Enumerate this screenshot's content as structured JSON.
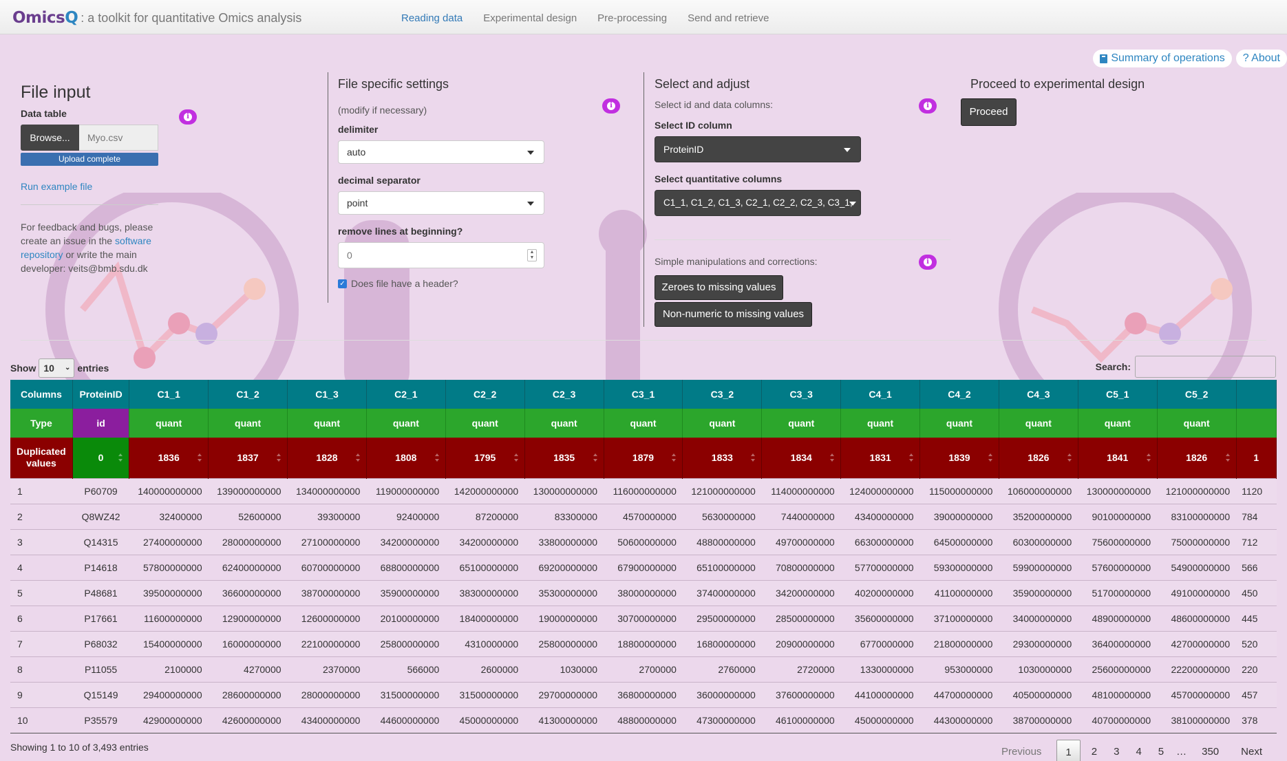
{
  "nav": {
    "brand": "Omics",
    "brand_q": "Q",
    "subtitle": ": a toolkit for quantitative Omics analysis",
    "tabs": [
      "Reading data",
      "Experimental design",
      "Pre-processing",
      "Send and retrieve"
    ],
    "active_tab": "Reading data"
  },
  "top_buttons": {
    "summary": "Summary of operations",
    "about": "? About"
  },
  "file_input": {
    "title": "File input",
    "data_table_label": "Data table",
    "browse_label": "Browse...",
    "file_name": "Myo.csv",
    "upload_status": "Upload complete",
    "run_example": "Run example file",
    "feedback_1": "For feedback and bugs, please create an issue in the",
    "feedback_link": "software repository",
    "feedback_2": "or write the main developer: veits@bmb.sdu.dk"
  },
  "file_settings": {
    "title": "File specific settings",
    "subtitle": "(modify if necessary)",
    "delimiter_label": "delimiter",
    "delimiter_value": "auto",
    "decimal_label": "decimal separator",
    "decimal_value": "point",
    "remove_lines_label": "remove lines at beginning?",
    "remove_lines_value": "0",
    "header_label": "Does file have a header?",
    "header_checked": true
  },
  "select_adjust": {
    "title": "Select and adjust",
    "subtitle": "Select id and data columns:",
    "id_label": "Select ID column",
    "id_value": "ProteinID",
    "quant_label": "Select quantitative columns",
    "quant_value": "C1_1, C1_2, C1_3, C2_1, C2_2, C2_3, C3_1,",
    "manip_label": "Simple manipulations and corrections:",
    "zeroes_btn": "Zeroes to missing values",
    "nonnumeric_btn": "Non-numeric to missing values"
  },
  "proceed": {
    "title": "Proceed to experimental design",
    "button": "Proceed"
  },
  "table_controls": {
    "show_label": "Show",
    "show_value": "10",
    "entries_label": "entries",
    "search_label": "Search:",
    "info": "Showing 1 to 10 of 3,493 entries"
  },
  "table": {
    "row_label_columns": "Columns",
    "row_label_type": "Type",
    "row_label_dup": "Duplicated values",
    "columns": [
      "ProteinID",
      "C1_1",
      "C1_2",
      "C1_3",
      "C2_1",
      "C2_2",
      "C2_3",
      "C3_1",
      "C3_2",
      "C3_3",
      "C4_1",
      "C4_2",
      "C4_3",
      "C5_1",
      "C5_2",
      ""
    ],
    "types": [
      "id",
      "quant",
      "quant",
      "quant",
      "quant",
      "quant",
      "quant",
      "quant",
      "quant",
      "quant",
      "quant",
      "quant",
      "quant",
      "quant",
      "quant",
      ""
    ],
    "duplicates": [
      "0",
      "1836",
      "1837",
      "1828",
      "1808",
      "1795",
      "1835",
      "1879",
      "1833",
      "1834",
      "1831",
      "1839",
      "1826",
      "1841",
      "1826",
      "1"
    ],
    "rows": [
      [
        "1",
        "P60709",
        "140000000000",
        "139000000000",
        "134000000000",
        "119000000000",
        "142000000000",
        "130000000000",
        "116000000000",
        "121000000000",
        "114000000000",
        "124000000000",
        "115000000000",
        "106000000000",
        "130000000000",
        "121000000000",
        "1120"
      ],
      [
        "2",
        "Q8WZ42",
        "32400000",
        "52600000",
        "39300000",
        "92400000",
        "87200000",
        "83300000",
        "4570000000",
        "5630000000",
        "7440000000",
        "43400000000",
        "39000000000",
        "35200000000",
        "90100000000",
        "83100000000",
        "784"
      ],
      [
        "3",
        "Q14315",
        "27400000000",
        "28000000000",
        "27100000000",
        "34200000000",
        "34200000000",
        "33800000000",
        "50600000000",
        "48800000000",
        "49700000000",
        "66300000000",
        "64500000000",
        "60300000000",
        "75600000000",
        "75000000000",
        "712"
      ],
      [
        "4",
        "P14618",
        "57800000000",
        "62400000000",
        "60700000000",
        "68800000000",
        "65100000000",
        "69200000000",
        "67900000000",
        "65100000000",
        "70800000000",
        "57700000000",
        "59300000000",
        "59900000000",
        "57600000000",
        "54900000000",
        "566"
      ],
      [
        "5",
        "P48681",
        "39500000000",
        "36600000000",
        "38700000000",
        "35900000000",
        "38300000000",
        "35300000000",
        "38000000000",
        "37400000000",
        "34200000000",
        "40200000000",
        "41100000000",
        "35900000000",
        "51700000000",
        "49100000000",
        "450"
      ],
      [
        "6",
        "P17661",
        "11600000000",
        "12900000000",
        "12600000000",
        "20100000000",
        "18400000000",
        "19000000000",
        "30700000000",
        "29500000000",
        "28500000000",
        "35600000000",
        "37100000000",
        "34000000000",
        "48900000000",
        "48600000000",
        "445"
      ],
      [
        "7",
        "P68032",
        "15400000000",
        "16000000000",
        "22100000000",
        "25800000000",
        "4310000000",
        "25800000000",
        "18800000000",
        "16800000000",
        "20900000000",
        "6770000000",
        "21800000000",
        "29300000000",
        "36400000000",
        "42700000000",
        "520"
      ],
      [
        "8",
        "P11055",
        "2100000",
        "4270000",
        "2370000",
        "566000",
        "2600000",
        "1030000",
        "2700000",
        "2760000",
        "2720000",
        "1330000000",
        "953000000",
        "1030000000",
        "25600000000",
        "22200000000",
        "220"
      ],
      [
        "9",
        "Q15149",
        "29400000000",
        "28600000000",
        "28000000000",
        "31500000000",
        "31500000000",
        "29700000000",
        "36800000000",
        "36000000000",
        "37600000000",
        "44100000000",
        "44700000000",
        "40500000000",
        "48100000000",
        "45700000000",
        "457"
      ],
      [
        "10",
        "P35579",
        "42900000000",
        "42600000000",
        "43400000000",
        "44600000000",
        "45000000000",
        "41300000000",
        "48800000000",
        "47300000000",
        "46100000000",
        "45000000000",
        "44300000000",
        "38700000000",
        "40700000000",
        "38100000000",
        "378"
      ]
    ]
  },
  "pager": {
    "previous": "Previous",
    "pages": [
      "1",
      "2",
      "3",
      "4",
      "5",
      "…",
      "350"
    ],
    "current": "1",
    "next": "Next"
  },
  "colors": {
    "teal": "#017b87",
    "green": "#2ca62c",
    "purple_id": "#8b1e9e",
    "darkred": "#8b0000",
    "info": "#c12fe0",
    "link": "#2e86c1",
    "bg": "#ecd8ec"
  }
}
